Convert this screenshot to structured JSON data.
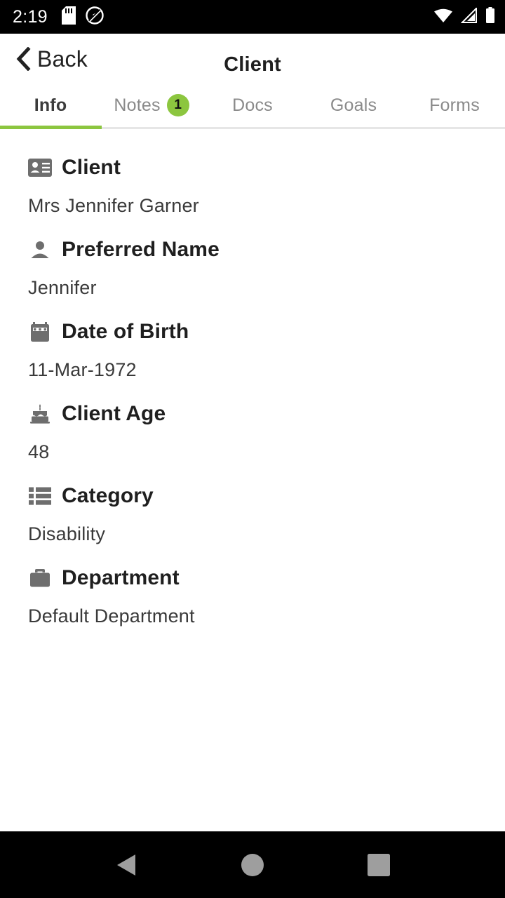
{
  "status_bar": {
    "time": "2:19",
    "left_icons": [
      "sd-card-icon",
      "location-off-icon"
    ],
    "right_icons": [
      "wifi-icon",
      "cellular-signal-icon",
      "battery-icon"
    ],
    "background_color": "#000000",
    "foreground_color": "#ffffff"
  },
  "header": {
    "back_label": "Back",
    "back_icon": "chevron-left-icon",
    "title": "Client"
  },
  "tabs": {
    "active_index": 0,
    "accent_color": "#8cc63f",
    "items": [
      {
        "label": "Info",
        "badge": null
      },
      {
        "label": "Notes",
        "badge": "1"
      },
      {
        "label": "Docs",
        "badge": null
      },
      {
        "label": "Goals",
        "badge": null
      },
      {
        "label": "Forms",
        "badge": null
      }
    ]
  },
  "fields": [
    {
      "icon": "contact-card-icon",
      "label": "Client",
      "value": "Mrs Jennifer Garner"
    },
    {
      "icon": "person-icon",
      "label": "Preferred Name",
      "value": "Jennifer"
    },
    {
      "icon": "calendar-icon",
      "label": "Date of Birth",
      "value": "11-Mar-1972"
    },
    {
      "icon": "birthday-cake-icon",
      "label": "Client Age",
      "value": "48"
    },
    {
      "icon": "list-icon",
      "label": "Category",
      "value": "Disability"
    },
    {
      "icon": "briefcase-icon",
      "label": "Department",
      "value": "Default Department"
    }
  ],
  "nav_bar": {
    "buttons": [
      "back-triangle-icon",
      "home-circle-icon",
      "recents-square-icon"
    ],
    "background_color": "#000000",
    "icon_color": "#9e9e9e"
  }
}
